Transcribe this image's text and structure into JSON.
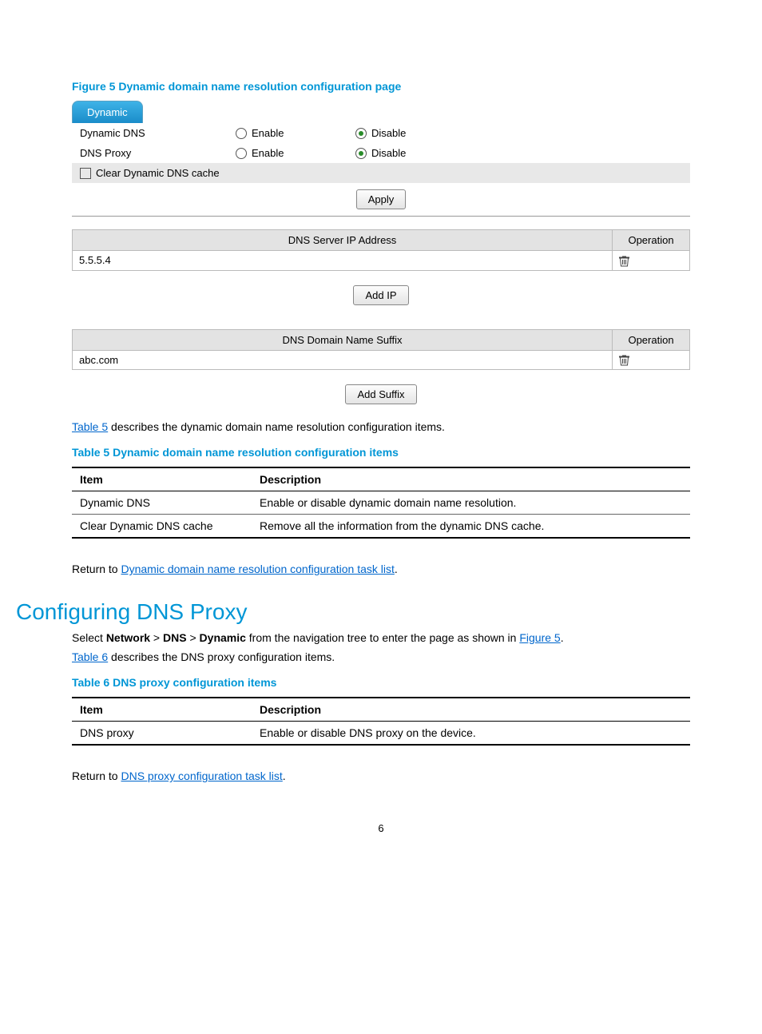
{
  "figure5": {
    "caption": "Figure 5 Dynamic domain name resolution configuration page",
    "tab": "Dynamic",
    "rows": {
      "dynamic_dns": {
        "label": "Dynamic DNS",
        "enable": "Enable",
        "disable": "Disable",
        "selected": "disable"
      },
      "dns_proxy": {
        "label": "DNS Proxy",
        "enable": "Enable",
        "disable": "Disable",
        "selected": "disable"
      }
    },
    "clear_cache": "Clear Dynamic DNS cache",
    "apply": "Apply",
    "ip_table": {
      "header_addr": "DNS Server IP Address",
      "header_op": "Operation",
      "row1": "5.5.5.4"
    },
    "add_ip": "Add IP",
    "suffix_table": {
      "header_suffix": "DNS Domain Name Suffix",
      "header_op": "Operation",
      "row1": "abc.com"
    },
    "add_suffix": "Add Suffix"
  },
  "para_t5": {
    "link": "Table 5",
    "rest": " describes the dynamic domain name resolution configuration items."
  },
  "table5": {
    "caption": "Table 5 Dynamic domain name resolution configuration items",
    "h_item": "Item",
    "h_desc": "Description",
    "r1_item": "Dynamic DNS",
    "r1_desc": "Enable or disable dynamic domain name resolution.",
    "r2_item": "Clear Dynamic DNS cache",
    "r2_desc": "Remove all the information from the dynamic DNS cache."
  },
  "return1": {
    "prefix": "Return to ",
    "link": "Dynamic domain name resolution configuration task list",
    "suffix": "."
  },
  "heading": "Configuring DNS Proxy",
  "nav": {
    "p1": "Select ",
    "b1": "Network",
    "s1": " > ",
    "b2": "DNS",
    "s2": " > ",
    "b3": "Dynamic",
    "p2": " from the navigation tree to enter the page as shown in ",
    "link": "Figure 5",
    "suffix": "."
  },
  "para_t6": {
    "link": "Table 6",
    "rest": " describes the DNS proxy configuration items."
  },
  "table6": {
    "caption": "Table 6 DNS proxy configuration items",
    "h_item": "Item",
    "h_desc": "Description",
    "r1_item": "DNS proxy",
    "r1_desc": "Enable or disable DNS proxy on the device."
  },
  "return2": {
    "prefix": "Return to ",
    "link": "DNS proxy configuration task list",
    "suffix": "."
  },
  "page": "6"
}
